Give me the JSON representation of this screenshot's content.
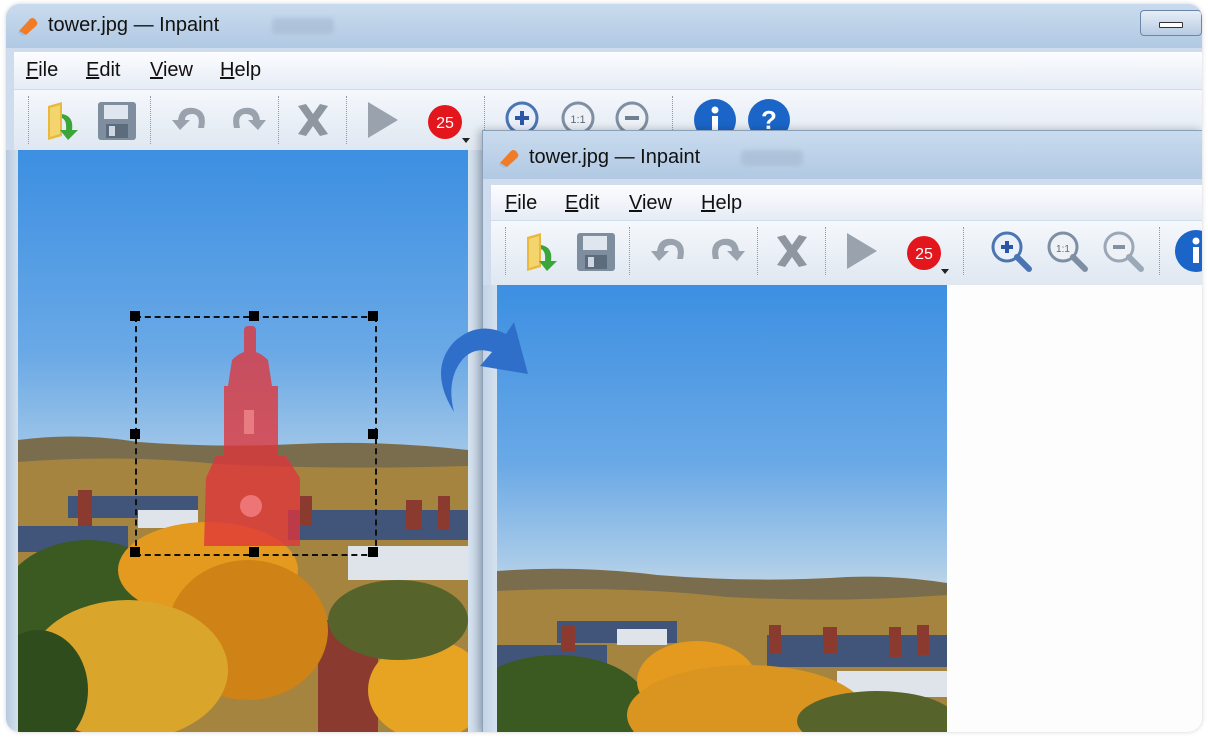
{
  "back_window": {
    "title": "tower.jpg — Inpaint",
    "menu": [
      {
        "mnemonic": "F",
        "rest": "ile"
      },
      {
        "mnemonic": "E",
        "rest": "dit"
      },
      {
        "mnemonic": "V",
        "rest": "iew"
      },
      {
        "mnemonic": "H",
        "rest": "elp"
      }
    ],
    "brush_size": "25"
  },
  "front_window": {
    "title": "tower.jpg — Inpaint",
    "menu": [
      {
        "mnemonic": "F",
        "rest": "ile"
      },
      {
        "mnemonic": "E",
        "rest": "dit"
      },
      {
        "mnemonic": "V",
        "rest": "iew"
      },
      {
        "mnemonic": "H",
        "rest": "elp"
      }
    ],
    "brush_size": "25"
  },
  "icons": {
    "open": "open-folder-icon",
    "save": "save-disk-icon",
    "undo": "undo-icon",
    "redo": "redo-icon",
    "clear": "clear-x-icon",
    "run": "run-play-icon",
    "brush": "brush-size-icon",
    "zoom_in": "zoom-in-icon",
    "zoom_actual": "zoom-actual-size-icon",
    "zoom_out": "zoom-out-icon",
    "info": "info-icon",
    "help": "help-icon",
    "transition": "curved-arrow-icon"
  },
  "colors": {
    "sky_top": "#3c8fe2",
    "selection_mask": "#e0353a",
    "arrow": "#2f6fc9",
    "info_button": "#1b65c8",
    "brush_badge": "#e4161d"
  }
}
